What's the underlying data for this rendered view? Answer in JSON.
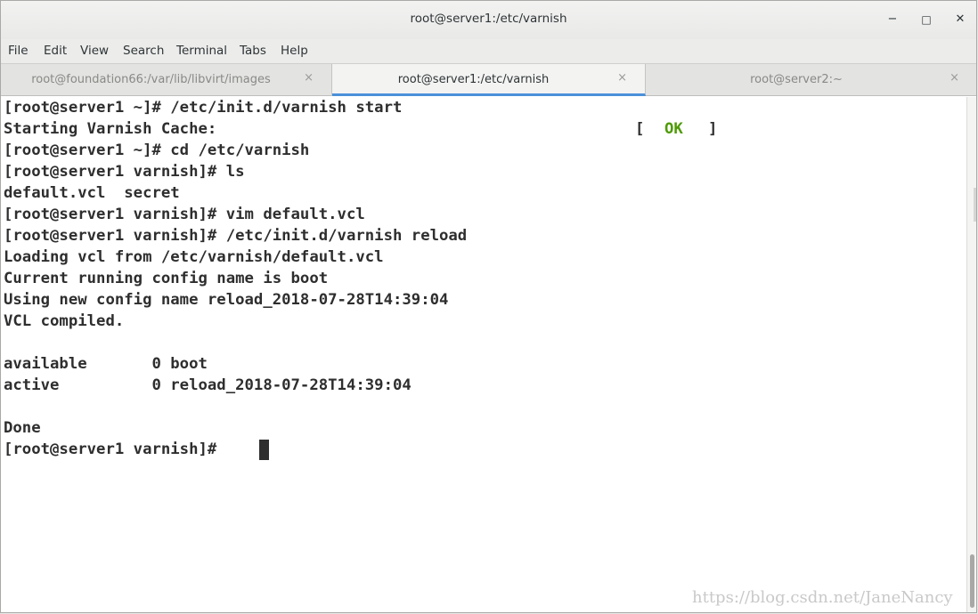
{
  "window": {
    "title": "root@server1:/etc/varnish",
    "minimize_icon": "minimize-icon",
    "maximize_icon": "maximize-icon",
    "close_icon": "close-icon",
    "minimize_glyph": "−",
    "maximize_glyph": "□",
    "close_glyph": "✕"
  },
  "menu": {
    "file": "File",
    "edit": "Edit",
    "view": "View",
    "search": "Search",
    "terminal": "Terminal",
    "tabs": "Tabs",
    "help": "Help"
  },
  "tabs": [
    {
      "label": "root@foundation66:/var/lib/libvirt/images",
      "active": false,
      "close": "×"
    },
    {
      "label": "root@server1:/etc/varnish",
      "active": true,
      "close": "×"
    },
    {
      "label": "root@server2:~",
      "active": false,
      "close": "×"
    }
  ],
  "terminal": {
    "lines": [
      "[root@server1 ~]# /etc/init.d/varnish start",
      "Starting Varnish Cache:",
      "[root@server1 ~]# cd /etc/varnish",
      "[root@server1 varnish]# ls",
      "default.vcl  secret",
      "[root@server1 varnish]# vim default.vcl",
      "[root@server1 varnish]# /etc/init.d/varnish reload",
      "Loading vcl from /etc/varnish/default.vcl",
      "Current running config name is boot",
      "Using new config name reload_2018-07-28T14:39:04",
      "VCL compiled.",
      "",
      "available       0 boot",
      "active          0 reload_2018-07-28T14:39:04",
      "",
      "Done",
      "[root@server1 varnish]# "
    ],
    "status_open": "[",
    "status_ok": "OK",
    "status_close": "]",
    "colors": {
      "ok": "#4e9a06",
      "text": "#2e2e2e",
      "background": "#ffffff",
      "active_tab_underline": "#4a90d9"
    }
  },
  "watermark": "https://blog.csdn.net/JaneNancy"
}
